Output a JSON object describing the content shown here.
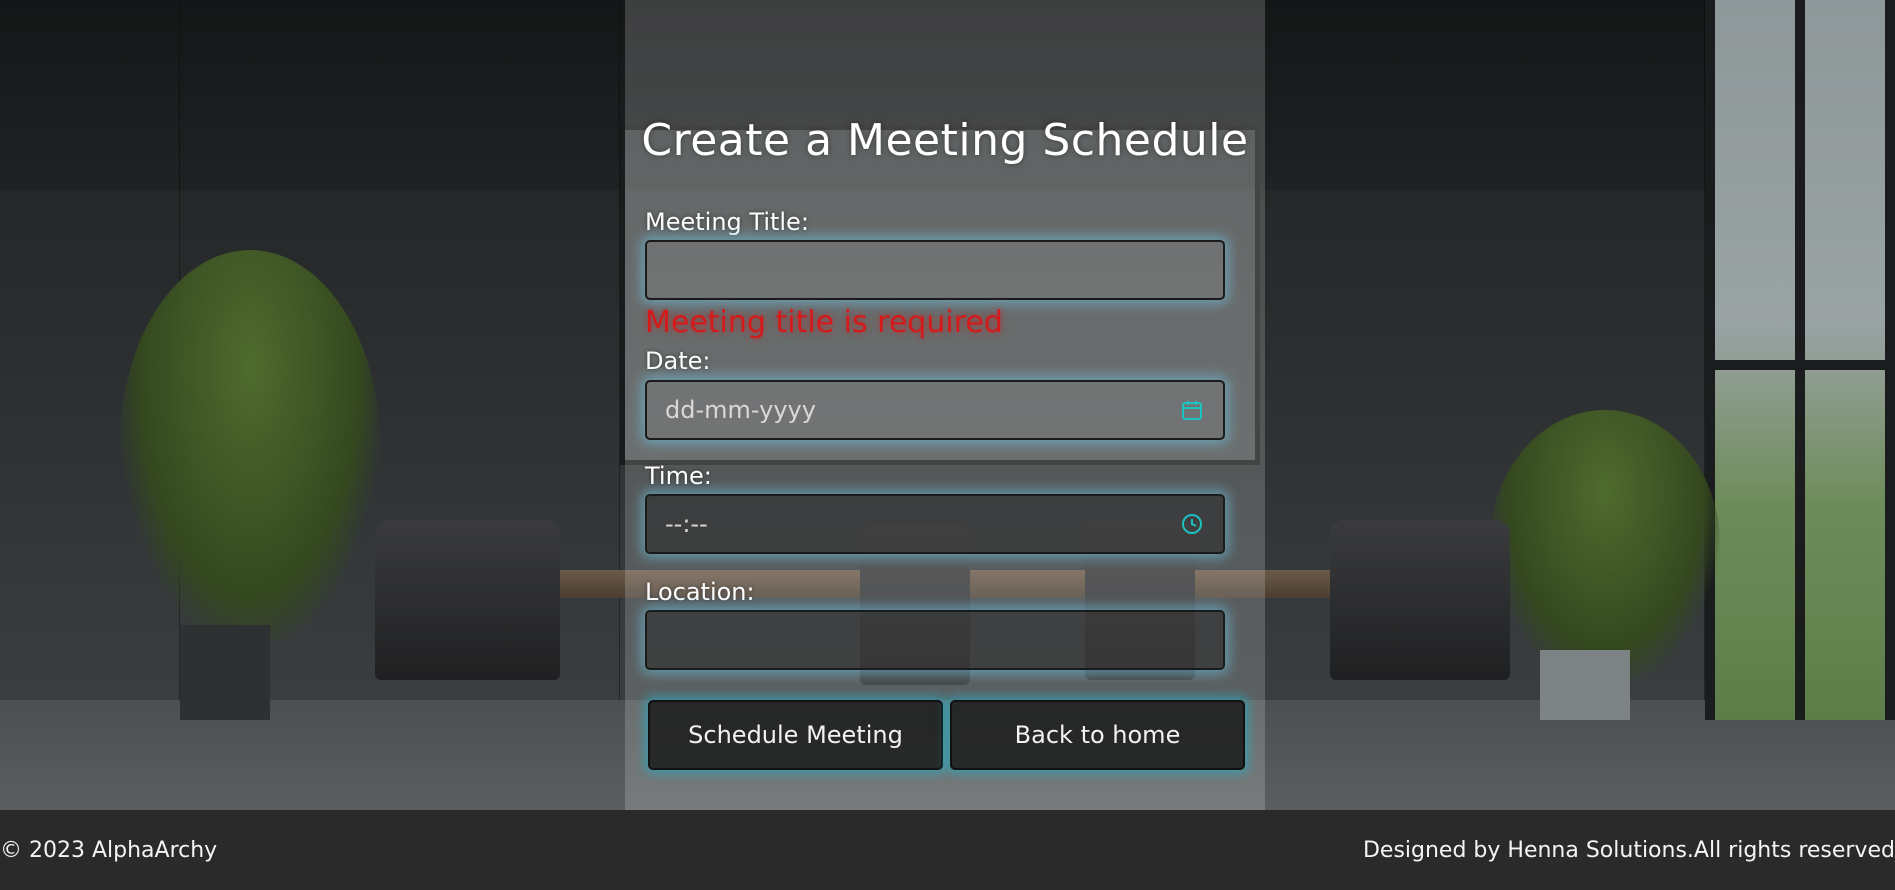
{
  "form": {
    "title": "Create a Meeting Schedule",
    "fields": {
      "meeting_title": {
        "label": "Meeting Title:",
        "value": "",
        "error": "Meeting title is required"
      },
      "date": {
        "label": "Date:",
        "placeholder": "dd-mm-yyyy",
        "icon": "calendar-icon"
      },
      "time": {
        "label": "Time:",
        "placeholder": "--:--",
        "icon": "clock-icon"
      },
      "location": {
        "label": "Location:",
        "value": ""
      }
    },
    "buttons": {
      "schedule": "Schedule Meeting",
      "back": "Back to home"
    }
  },
  "footer": {
    "copyright": "© 2023 AlphaArchy",
    "credits": "Designed by Henna Solutions.All rights reserved"
  },
  "colors": {
    "error": "#d41a1a",
    "icon_accent": "#1ec0c0",
    "glow": "#6ec8e6",
    "footer_bg": "#2b2a2b"
  }
}
